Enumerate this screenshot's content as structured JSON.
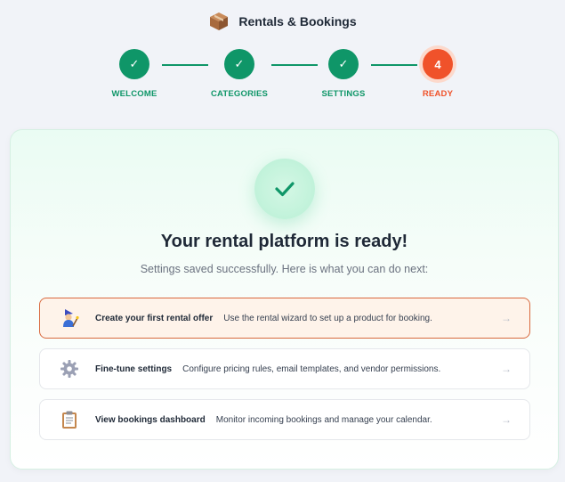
{
  "header": {
    "logo_icon": "package-icon",
    "title": "Rentals & Bookings"
  },
  "stepper": {
    "steps": [
      {
        "label": "WELCOME",
        "state": "done",
        "marker": "✓"
      },
      {
        "label": "CATEGORIES",
        "state": "done",
        "marker": "✓"
      },
      {
        "label": "SETTINGS",
        "state": "done",
        "marker": "✓"
      },
      {
        "label": "READY",
        "state": "current",
        "marker": "4"
      }
    ]
  },
  "card": {
    "icon": "check-icon",
    "title": "Your rental platform is ready!",
    "subtitle": "Settings saved successfully. Here is what you can do next:",
    "actions": [
      {
        "icon": "wizard-icon",
        "title": "Create your first rental offer",
        "description": "Use the rental wizard to set up a product for booking.",
        "arrow": "→"
      },
      {
        "icon": "gear-icon",
        "title": "Fine-tune settings",
        "description": "Configure pricing rules, email templates, and vendor permissions.",
        "arrow": "→"
      },
      {
        "icon": "clipboard-icon",
        "title": "View bookings dashboard",
        "description": "Monitor incoming bookings and manage your calendar.",
        "arrow": "→"
      }
    ]
  },
  "colors": {
    "success": "#0f9668",
    "current": "#f0522a",
    "highlight_border": "#d9693e",
    "highlight_bg": "#fef3ea"
  }
}
